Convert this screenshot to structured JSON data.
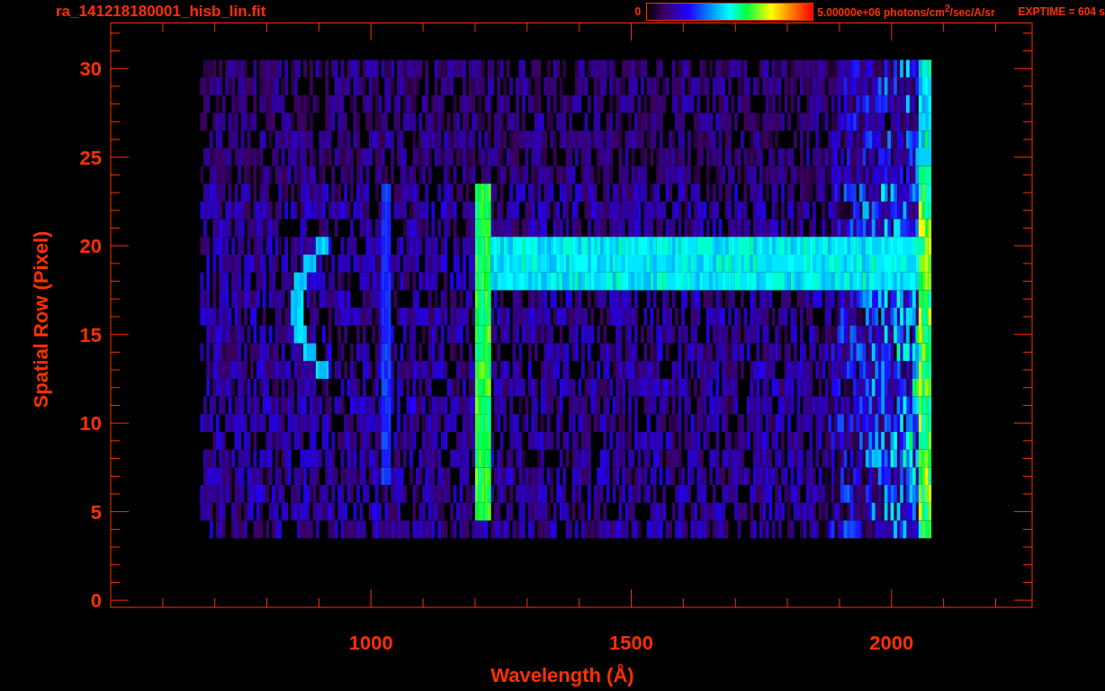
{
  "header": {
    "title": "ra_141218180001_hisb_lin.fit",
    "colorbar_min": "0",
    "colorbar_max": "5.00000e+06 photons/cm$^{2}$/sec/A/sr",
    "exptime": "EXPTIME = 604 s"
  },
  "plot": {
    "x_axis": {
      "title": "Wavelength (Å)",
      "tick_labels": [
        "1000",
        "1500",
        "2000"
      ]
    },
    "y_axis": {
      "title": "Spatial Row (Pixel)",
      "tick_labels": [
        "30",
        "25",
        "20",
        "15",
        "10",
        "5",
        "0"
      ]
    }
  }
}
